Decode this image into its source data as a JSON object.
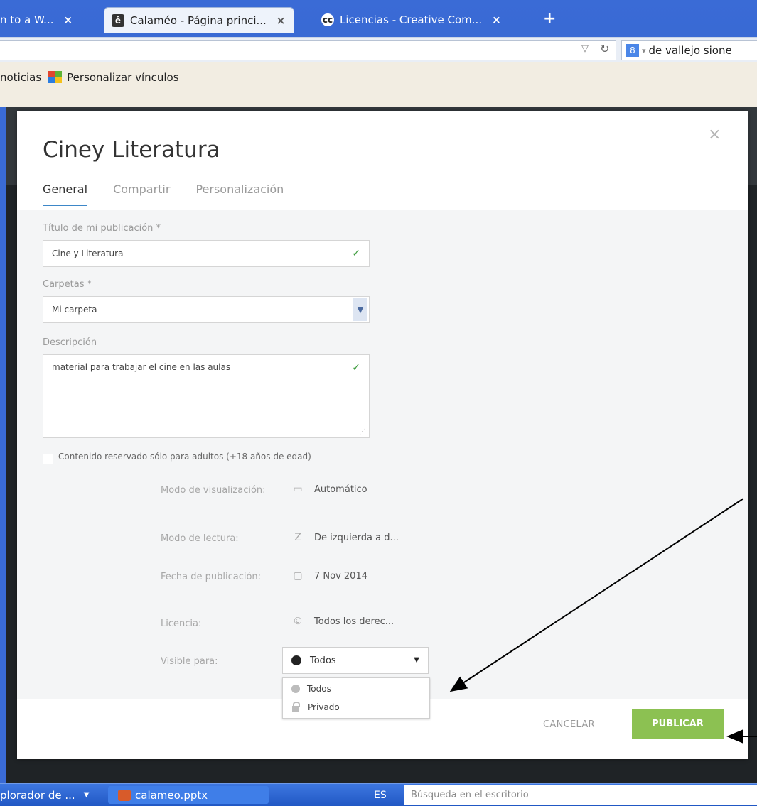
{
  "browser": {
    "tabs": [
      {
        "label": "n to a W...",
        "close": "×"
      },
      {
        "label": "Calaméo - Página princi...",
        "close": "×"
      },
      {
        "label": "Licencias - Creative Com...",
        "close": "×"
      }
    ],
    "new_tab": "+",
    "search_text": "de vallejo sione",
    "bookmark_prefix": "noticias",
    "bookmark_item": "Personalizar vínculos"
  },
  "modal": {
    "title": "Ciney Literatura",
    "close": "×",
    "tabs": [
      "General",
      "Compartir",
      "Personalización"
    ],
    "fields": {
      "title_label": "Título de mi publicación *",
      "title_value": "Cine y Literatura",
      "folders_label": "Carpetas *",
      "folders_value": "Mi carpeta",
      "description_label": "Descripción",
      "description_value": "material para trabajar el cine en las aulas",
      "adult_label": "Contenido reservado sólo para adultos (+18 años de edad)"
    },
    "properties": {
      "display_mode_label": "Modo de visualización:",
      "display_mode_value": "Automático",
      "reading_mode_label": "Modo de lectura:",
      "reading_mode_value": "De izquierda a d...",
      "pub_date_label": "Fecha de publicación:",
      "pub_date_value": "7 Nov 2014",
      "license_label": "Licencia:",
      "license_value": "Todos los derec...",
      "visible_label": "Visible para:",
      "visible_value": "Todos"
    },
    "dropdown_options": [
      "Todos",
      "Privado"
    ],
    "cancel": "CANCELAR",
    "publish": "PUBLICAR"
  },
  "taskbar": {
    "explorer": "plorador de ...",
    "ppt": "calameo.pptx",
    "lang": "ES",
    "desktop_search_placeholder": "Búsqueda en el escritorio"
  },
  "colors": {
    "accent_tab": "#3d87c8",
    "publish_green": "#8cc152",
    "check_green": "#3a9a3a"
  }
}
